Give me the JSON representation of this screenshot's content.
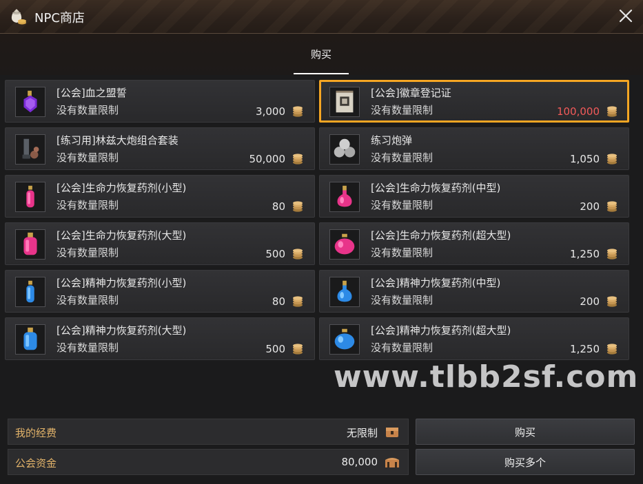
{
  "window": {
    "title": "NPC商店"
  },
  "tabs": [
    {
      "label": "购买",
      "active": true
    }
  ],
  "items": [
    {
      "name": "[公会]血之盟誓",
      "limit": "没有数量限制",
      "price": "3,000",
      "icon": "purple-potion-icon"
    },
    {
      "name": "[公会]徽章登记证",
      "limit": "没有数量限制",
      "price": "100,000",
      "icon": "certificate-scroll-icon",
      "selected": true,
      "price_color": "#f25a5a"
    },
    {
      "name": "[练习用]林兹大炮组合套装",
      "limit": "没有数量限制",
      "price": "50,000",
      "icon": "cannon-set-icon"
    },
    {
      "name": "练习炮弹",
      "limit": "没有数量限制",
      "price": "1,050",
      "icon": "cannonballs-icon"
    },
    {
      "name": "[公会]生命力恢复药剂(小型)",
      "limit": "没有数量限制",
      "price": "80",
      "icon": "pink-potion-small-icon"
    },
    {
      "name": "[公会]生命力恢复药剂(中型)",
      "limit": "没有数量限制",
      "price": "200",
      "icon": "pink-potion-medium-icon"
    },
    {
      "name": "[公会]生命力恢复药剂(大型)",
      "limit": "没有数量限制",
      "price": "500",
      "icon": "pink-potion-large-icon"
    },
    {
      "name": "[公会]生命力恢复药剂(超大型)",
      "limit": "没有数量限制",
      "price": "1,250",
      "icon": "pink-potion-xl-icon"
    },
    {
      "name": "[公会]精神力恢复药剂(小型)",
      "limit": "没有数量限制",
      "price": "80",
      "icon": "blue-potion-small-icon"
    },
    {
      "name": "[公会]精神力恢复药剂(中型)",
      "limit": "没有数量限制",
      "price": "200",
      "icon": "blue-potion-medium-icon"
    },
    {
      "name": "[公会]精神力恢复药剂(大型)",
      "limit": "没有数量限制",
      "price": "500",
      "icon": "blue-potion-large-icon"
    },
    {
      "name": "[公会]精神力恢复药剂(超大型)",
      "limit": "没有数量限制",
      "price": "1,250",
      "icon": "blue-potion-xl-icon"
    }
  ],
  "watermark": "www.tlbb2sf.com",
  "footer": {
    "my_funds": {
      "label": "我的经费",
      "value": "无限制",
      "icon": "treasure-chest-icon"
    },
    "guild_funds": {
      "label": "公会资金",
      "value": "80,000",
      "icon": "guild-chest-icon"
    }
  },
  "buttons": {
    "buy": "购买",
    "buy_multiple": "购买多个"
  },
  "colors": {
    "selection": "#f6a623",
    "accent_text": "#e2b36a",
    "expensive_price": "#f25a5a"
  }
}
